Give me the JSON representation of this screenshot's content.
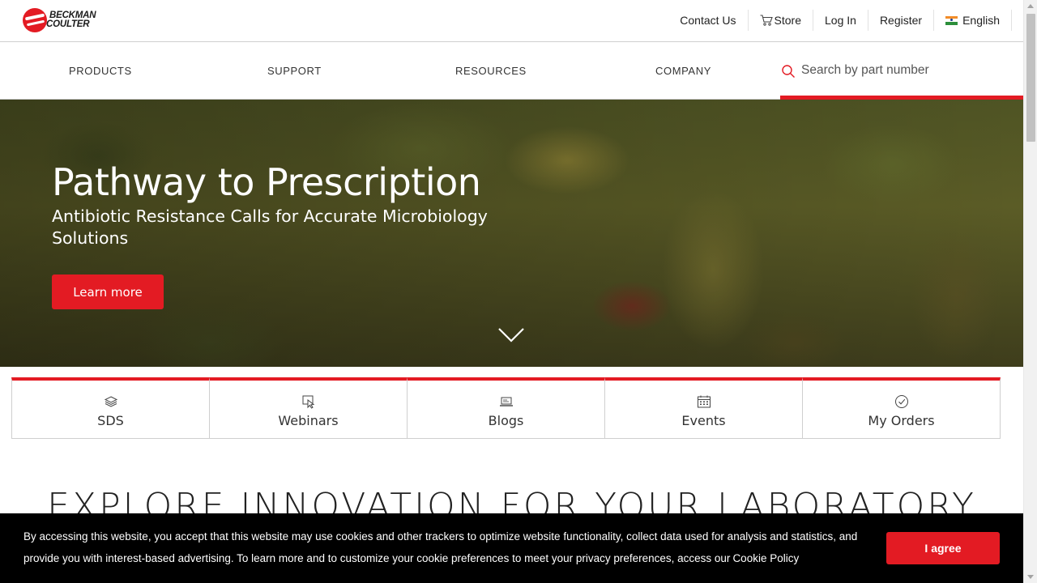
{
  "brand": {
    "logo_line1": "BECKMAN",
    "logo_line2": "COULTER",
    "accent_color": "#e31b23"
  },
  "utility_nav": {
    "contact": "Contact Us",
    "store": "Store",
    "login": "Log In",
    "register": "Register",
    "language": "English",
    "language_icon": "india-flag-icon",
    "store_icon": "cart-icon"
  },
  "main_nav": {
    "items": [
      "PRODUCTS",
      "SUPPORT",
      "RESOURCES",
      "COMPANY"
    ],
    "search_placeholder": "Search by part number",
    "search_value": ""
  },
  "hero": {
    "title": "Pathway to Prescription",
    "subtitle": "Antibiotic Resistance Calls for Accurate Microbiology Solutions",
    "cta": "Learn more",
    "scroll_icon": "chevron-down-icon"
  },
  "quick_links": [
    {
      "label": "SDS",
      "icon": "layers-icon"
    },
    {
      "label": "Webinars",
      "icon": "webinar-cursor-icon"
    },
    {
      "label": "Blogs",
      "icon": "laptop-icon"
    },
    {
      "label": "Events",
      "icon": "calendar-icon"
    },
    {
      "label": "My Orders",
      "icon": "check-circle-icon"
    }
  ],
  "explore_heading": "EXPLORE INNOVATION FOR YOUR LABORATORY",
  "cookie_banner": {
    "text": "By accessing this website, you accept that this website may use cookies and other trackers to optimize website functionality, collect data used for analysis and statistics, and provide you with interest-based advertising. To learn more and to customize your cookie preferences to meet your privacy preferences, access our",
    "link": "Cookie Policy",
    "accept": "I agree"
  }
}
